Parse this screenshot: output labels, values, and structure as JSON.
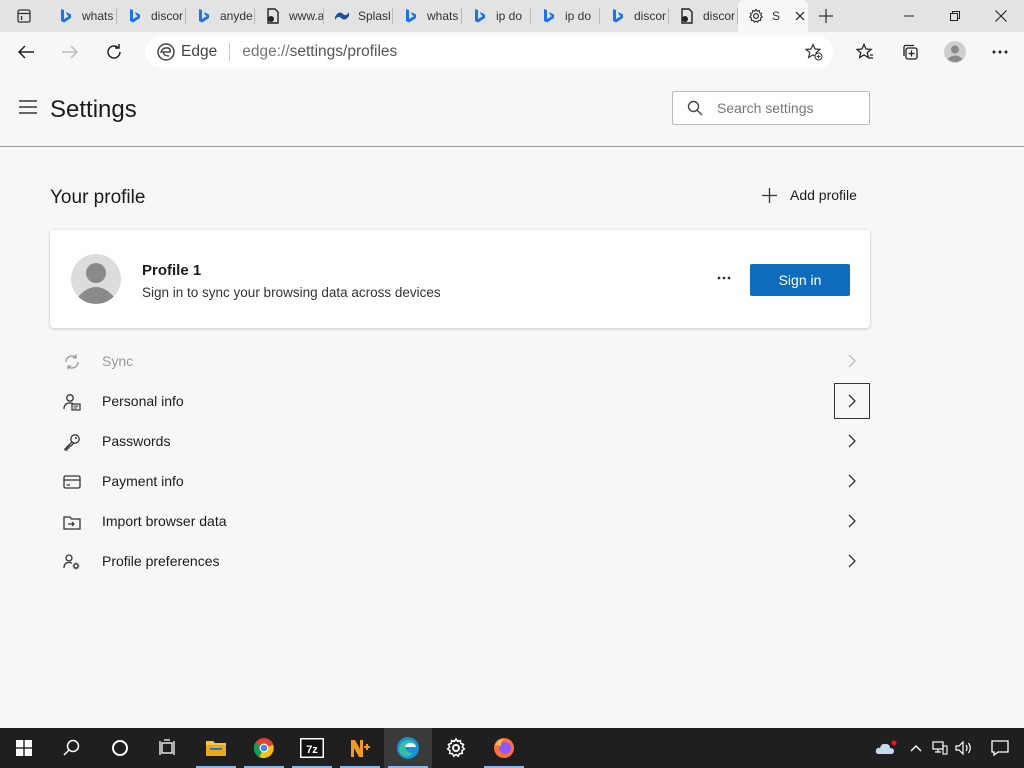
{
  "browser": {
    "tabs": [
      {
        "label": "whats",
        "icon": "bing-icon"
      },
      {
        "label": "discor",
        "icon": "bing-icon"
      },
      {
        "label": "anyde",
        "icon": "bing-icon"
      },
      {
        "label": "www.a",
        "icon": "document-icon"
      },
      {
        "label": "Splasl",
        "icon": "splashtop-icon"
      },
      {
        "label": "whats",
        "icon": "bing-icon"
      },
      {
        "label": "ip do",
        "icon": "bing-icon"
      },
      {
        "label": "ip do",
        "icon": "bing-icon"
      },
      {
        "label": "discor",
        "icon": "bing-icon"
      },
      {
        "label": "discor",
        "icon": "document-icon"
      }
    ],
    "active_tab": {
      "label": "S",
      "icon": "gear-icon"
    },
    "address": {
      "brand": "Edge",
      "scheme": "edge://",
      "path": "settings/profiles"
    }
  },
  "settings": {
    "title": "Settings",
    "search_placeholder": "Search settings",
    "section_title": "Your profile",
    "add_profile_label": "Add profile",
    "profile": {
      "name": "Profile 1",
      "subtitle": "Sign in to sync your browsing data across devices",
      "sign_in_label": "Sign in"
    },
    "menu": [
      {
        "label": "Sync",
        "icon": "sync-icon",
        "disabled": true
      },
      {
        "label": "Personal info",
        "icon": "personal-info-icon",
        "disabled": false
      },
      {
        "label": "Passwords",
        "icon": "key-icon",
        "disabled": false
      },
      {
        "label": "Payment info",
        "icon": "credit-card-icon",
        "disabled": false
      },
      {
        "label": "Import browser data",
        "icon": "import-icon",
        "disabled": false
      },
      {
        "label": "Profile preferences",
        "icon": "profile-preferences-icon",
        "disabled": false
      }
    ]
  },
  "colors": {
    "accent": "#0f6cbd",
    "taskbar": "#1f1f1f",
    "page_bg": "#f7f7f7"
  }
}
